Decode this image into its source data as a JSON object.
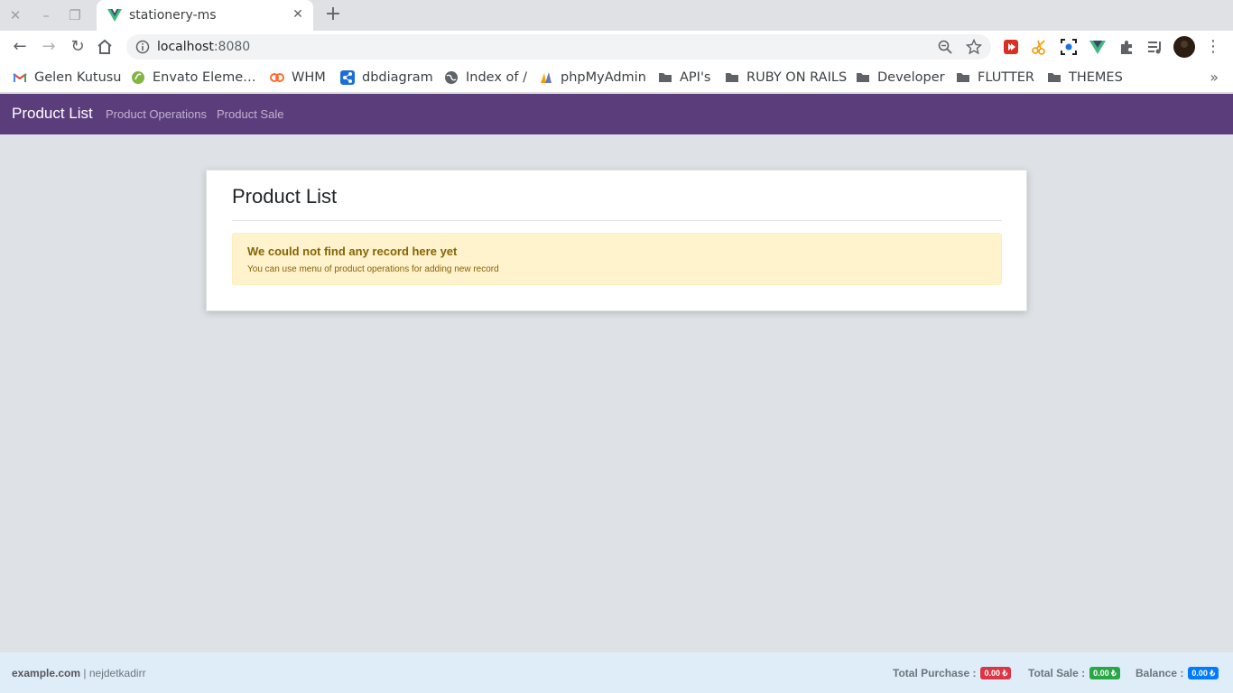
{
  "browser": {
    "tab_title": "stationery-ms",
    "url_host": "localhost",
    "url_port": ":8080",
    "bookmarks": [
      {
        "label": "Gelen Kutusu",
        "icon": "gmail-icon"
      },
      {
        "label": "Envato Eleme…",
        "icon": "envato-icon"
      },
      {
        "label": "WHM",
        "icon": "cpanel-icon"
      },
      {
        "label": "dbdiagram",
        "icon": "dbdiagram-icon"
      },
      {
        "label": "Index of /",
        "icon": "globe-icon"
      },
      {
        "label": "phpMyAdmin",
        "icon": "phpmyadmin-icon"
      },
      {
        "label": "API's",
        "icon": "folder-icon"
      },
      {
        "label": "RUBY ON RAILS",
        "icon": "folder-icon"
      },
      {
        "label": "Developer",
        "icon": "folder-icon"
      },
      {
        "label": "FLUTTER",
        "icon": "folder-icon"
      },
      {
        "label": "THEMES",
        "icon": "folder-icon"
      }
    ]
  },
  "navbar": {
    "brand": "Product List",
    "links": [
      "Product Operations",
      "Product Sale"
    ],
    "background": "#5c3d7c"
  },
  "main": {
    "title": "Product List",
    "alert": {
      "title": "We could not find any record here yet",
      "text": "You can use menu of product operations for adding new record"
    }
  },
  "footer": {
    "site": "example.com",
    "separator": "|",
    "user": "nejdetkadirr",
    "total_purchase_label": "Total Purchase :",
    "total_purchase_value": "0.00 ₺",
    "total_sale_label": "Total Sale :",
    "total_sale_value": "0.00 ₺",
    "balance_label": "Balance :",
    "balance_value": "0.00 ₺",
    "colors": {
      "purchase": "#dc3545",
      "sale": "#28a745",
      "balance": "#007bff"
    }
  }
}
